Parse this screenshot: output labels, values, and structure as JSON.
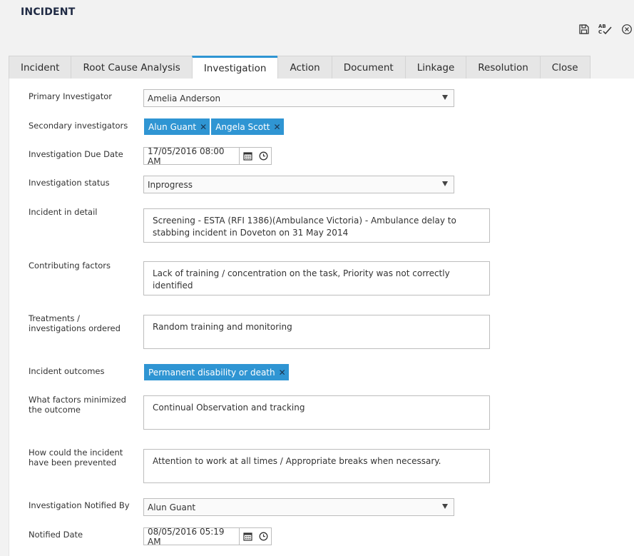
{
  "page": {
    "title": "INCIDENT"
  },
  "tabs": [
    {
      "label": "Incident"
    },
    {
      "label": "Root Cause Analysis"
    },
    {
      "label": "Investigation",
      "active": true
    },
    {
      "label": "Action"
    },
    {
      "label": "Document"
    },
    {
      "label": "Linkage"
    },
    {
      "label": "Resolution"
    },
    {
      "label": "Close"
    }
  ],
  "form": {
    "primary_investigator": {
      "label": "Primary Investigator",
      "value": "Amelia Anderson"
    },
    "secondary_investigators": {
      "label": "Secondary investigators",
      "tags": [
        "Alun Guant",
        "Angela Scott"
      ]
    },
    "due_date": {
      "label": "Investigation Due Date",
      "value": "17/05/2016 08:00 AM"
    },
    "status": {
      "label": "Investigation status",
      "value": "Inprogress"
    },
    "incident_detail": {
      "label": "Incident in detail",
      "value": "Screening - ESTA (RFI 1386)(Ambulance Victoria) - Ambulance delay to stabbing incident in Doveton on 31 May 2014"
    },
    "contributing_factors": {
      "label": "Contributing factors",
      "value": "Lack of training / concentration on the task, Priority was not correctly identified"
    },
    "treatments": {
      "label": "Treatments / investigations ordered",
      "value": "Random training and monitoring"
    },
    "outcomes": {
      "label": "Incident outcomes",
      "tags": [
        "Permanent disability or death"
      ]
    },
    "minimized_factors": {
      "label": "What factors minimized the outcome",
      "value": "Continual Observation and tracking"
    },
    "prevention": {
      "label": "How could the incident have been prevented",
      "value": "Attention to work at all times / Appropriate breaks when necessary."
    },
    "notified_by": {
      "label": "Investigation Notified By",
      "value": "Alun Guant"
    },
    "notified_date": {
      "label": "Notified Date",
      "value": "08/05/2016 05:19 AM"
    }
  },
  "colors": {
    "accent": "#2f95d3",
    "tag_text": "#ffffff",
    "title": "#1f2a44"
  }
}
